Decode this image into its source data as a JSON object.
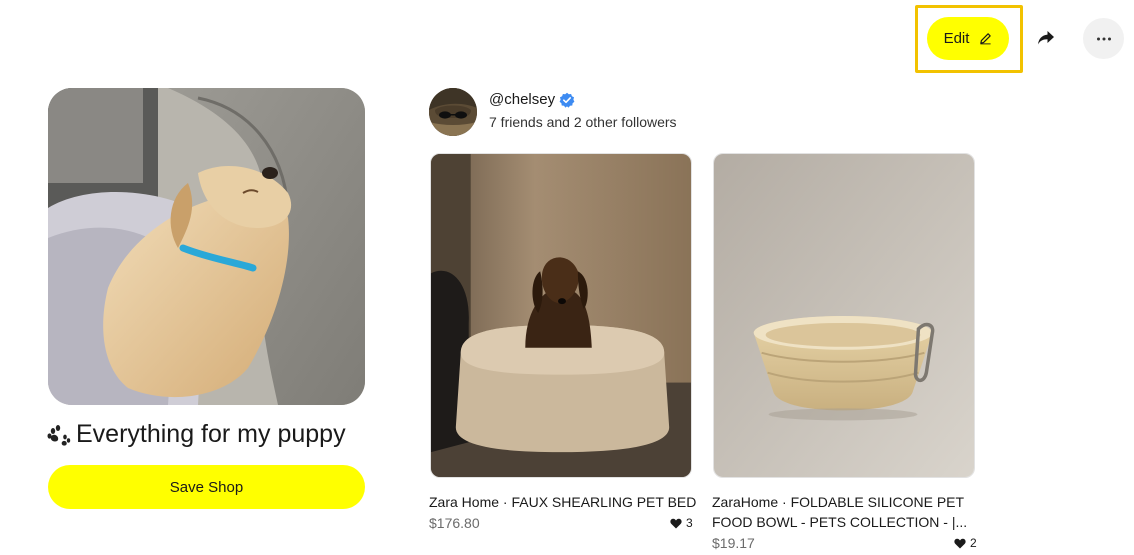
{
  "header": {
    "edit_label": "Edit",
    "edit_icon": "pencil-icon",
    "share_icon": "share-arrow-icon",
    "more_icon": "more-dots-icon"
  },
  "shop": {
    "emoji_icon": "paw-prints-icon",
    "title": "Everything for my puppy",
    "save_label": "Save Shop",
    "cover_image": "sleeping golden retriever puppy in car seat"
  },
  "profile": {
    "username": "@chelsey",
    "verified_icon": "verified-badge-icon",
    "followers_text": "7 friends and 2 other followers"
  },
  "products": [
    {
      "name": "Zara Home · FAUX SHEARLING PET BED",
      "price": "$176.80",
      "likes": "3",
      "image": "dachshund sitting in shearling pet bed"
    },
    {
      "name_line1": "ZaraHome · FOLDABLE SILICONE PET",
      "name_line2": "FOOD BOWL - PETS COLLECTION - |...",
      "price": "$19.17",
      "likes": "2",
      "image": "beige foldable silicone bowl with carabiner"
    }
  ],
  "colors": {
    "accent_yellow": "#ffff00",
    "highlight_border": "#f2c200",
    "verified_blue": "#3d8bf2"
  }
}
